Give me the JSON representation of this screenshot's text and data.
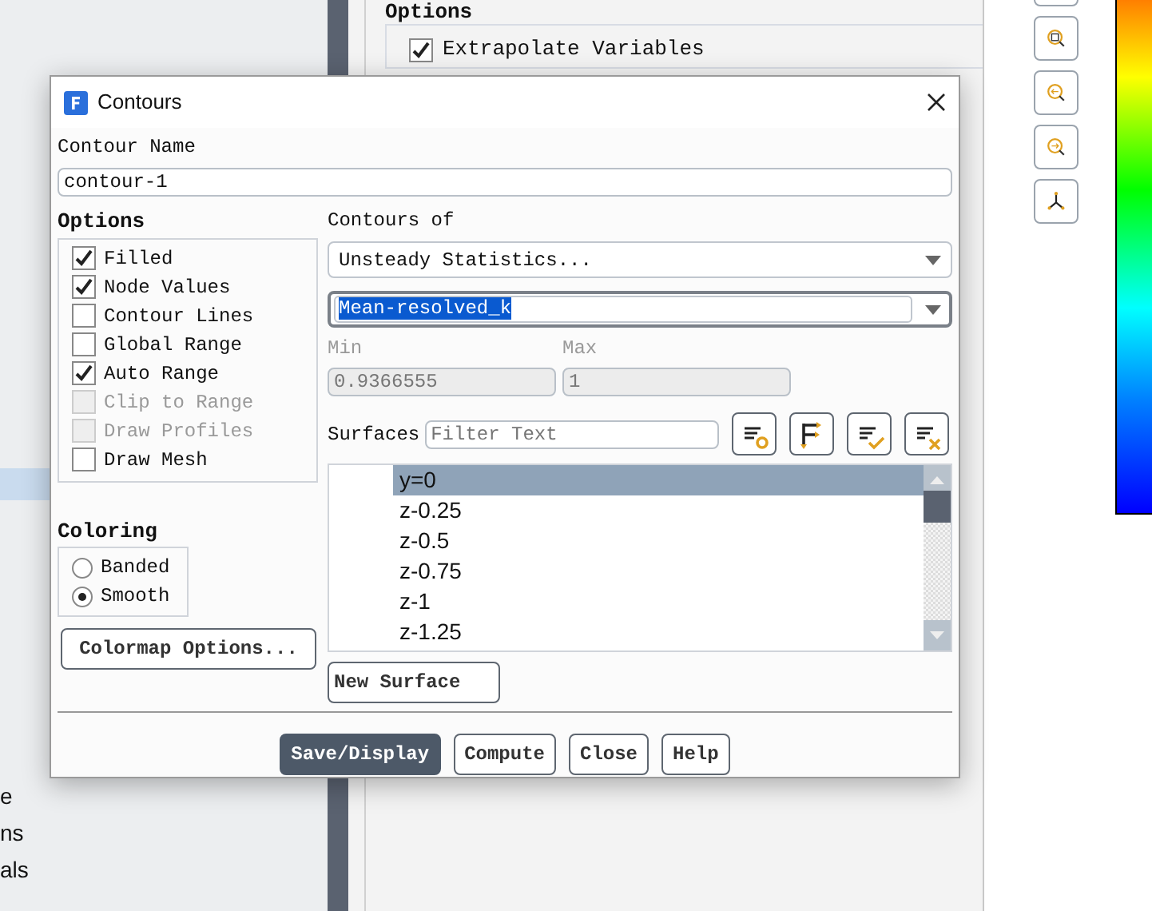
{
  "background": {
    "options_title": "Options",
    "options": [
      {
        "label": "Extrapolate Variables",
        "checked": true
      }
    ],
    "sidebar_items": [
      {
        "label": "e"
      },
      {
        "label": "ns"
      },
      {
        "label": "als"
      }
    ]
  },
  "dialog": {
    "title": "Contours",
    "contour_name_label": "Contour Name",
    "contour_name": "contour-1",
    "options_title": "Options",
    "options": [
      {
        "label": "Filled",
        "checked": true,
        "disabled": false
      },
      {
        "label": "Node Values",
        "checked": true,
        "disabled": false
      },
      {
        "label": "Contour Lines",
        "checked": false,
        "disabled": false
      },
      {
        "label": "Global Range",
        "checked": false,
        "disabled": false
      },
      {
        "label": "Auto Range",
        "checked": true,
        "disabled": false
      },
      {
        "label": "Clip to Range",
        "checked": false,
        "disabled": true
      },
      {
        "label": "Draw Profiles",
        "checked": false,
        "disabled": true
      },
      {
        "label": "Draw Mesh",
        "checked": false,
        "disabled": false
      }
    ],
    "coloring_title": "Coloring",
    "coloring": [
      {
        "label": "Banded",
        "selected": false
      },
      {
        "label": "Smooth",
        "selected": true
      }
    ],
    "colormap_button": "Colormap Options...",
    "contours_of_label": "Contours of",
    "contours_of": "Unsteady Statistics...",
    "variable": "Mean-resolved_k",
    "min_label": "Min",
    "min": "0.9366555",
    "max_label": "Max",
    "max": "1",
    "surfaces_label": "Surfaces",
    "filter_placeholder": "Filter Text",
    "surfaces": [
      {
        "label": "y=0",
        "selected": true
      },
      {
        "label": "z-0.25",
        "selected": false
      },
      {
        "label": "z-0.5",
        "selected": false
      },
      {
        "label": "z-0.75",
        "selected": false
      },
      {
        "label": "z-1",
        "selected": false
      },
      {
        "label": "z-1.25",
        "selected": false
      }
    ],
    "new_surface_button": "New Surface",
    "buttons": [
      {
        "label": "Save/Display",
        "primary": true
      },
      {
        "label": "Compute",
        "primary": false
      },
      {
        "label": "Close",
        "primary": false
      },
      {
        "label": "Help",
        "primary": false
      }
    ]
  }
}
